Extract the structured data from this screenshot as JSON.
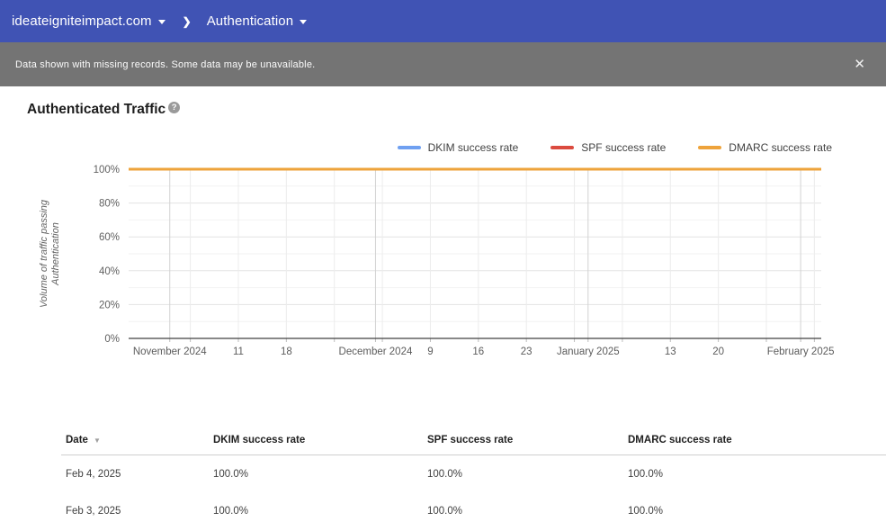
{
  "top_bar": {
    "domain": "ideateigniteimpact.com",
    "section": "Authentication",
    "separator": "❯"
  },
  "banner": {
    "message": "Data shown with missing records. Some data may be unavailable.",
    "close_label": "✕"
  },
  "page": {
    "title": "Authenticated Traffic",
    "help_icon_glyph": "?"
  },
  "colors": {
    "top_bar_blue": "#4053b4",
    "banner_gray": "#747474",
    "dkim_blue": "#6fa0f1",
    "spf_red": "#db4b3f",
    "dmarc_orange": "#eea33b",
    "axis": "#424242",
    "y_label_text": "#616161",
    "x_label_text": "#5c5c5c"
  },
  "chart_data": {
    "type": "line",
    "title": "Authenticated Traffic",
    "ylabel": "Volume of traffic passing Authentication",
    "ylabel_lines": [
      "Volume of traffic passing",
      "Authentication"
    ],
    "ylim": [
      0,
      100
    ],
    "y_ticks": [
      {
        "value": 0,
        "label": "0%"
      },
      {
        "value": 20,
        "label": "20%"
      },
      {
        "value": 40,
        "label": "40%"
      },
      {
        "value": 60,
        "label": "60%"
      },
      {
        "value": 80,
        "label": "80%"
      },
      {
        "value": 100,
        "label": "100%"
      }
    ],
    "y_minor_gridline_step": 10,
    "grid": true,
    "legend_position": "top-right",
    "x_domain_note": "days are offsets from 2024-11-01; plotted range 2024-10-26 to 2025-02-04",
    "x_domain_days": [
      -6,
      95
    ],
    "x_week_gridlines_days": [
      3,
      10,
      17,
      24,
      31,
      38,
      45,
      52,
      59,
      66,
      73,
      80,
      87,
      94
    ],
    "x_month_gridlines_days": [
      0,
      30,
      61,
      92
    ],
    "x_ticks": [
      {
        "day": 0,
        "label": "November 2024"
      },
      {
        "day": 10,
        "label": "11"
      },
      {
        "day": 17,
        "label": "18"
      },
      {
        "day": 30,
        "label": "December 2024"
      },
      {
        "day": 38,
        "label": "9"
      },
      {
        "day": 45,
        "label": "16"
      },
      {
        "day": 52,
        "label": "23"
      },
      {
        "day": 61,
        "label": "January 2025"
      },
      {
        "day": 73,
        "label": "13"
      },
      {
        "day": 80,
        "label": "20"
      },
      {
        "day": 92,
        "label": "February 2025"
      }
    ],
    "series": [
      {
        "name": "DKIM success rate",
        "color": "#6fa0f1",
        "constant_value_percent": 100
      },
      {
        "name": "SPF success rate",
        "color": "#db4b3f",
        "constant_value_percent": 100
      },
      {
        "name": "DMARC success rate",
        "color": "#eea33b",
        "constant_value_percent": 100
      }
    ]
  },
  "table": {
    "columns": [
      "Date",
      "DKIM success rate",
      "SPF success rate",
      "DMARC success rate"
    ],
    "sort_column": "Date",
    "sort_icon": "▼",
    "rows": [
      {
        "date": "Feb 4, 2025",
        "dkim": "100.0%",
        "spf": "100.0%",
        "dmarc": "100.0%"
      },
      {
        "date": "Feb 3, 2025",
        "dkim": "100.0%",
        "spf": "100.0%",
        "dmarc": "100.0%"
      }
    ]
  }
}
